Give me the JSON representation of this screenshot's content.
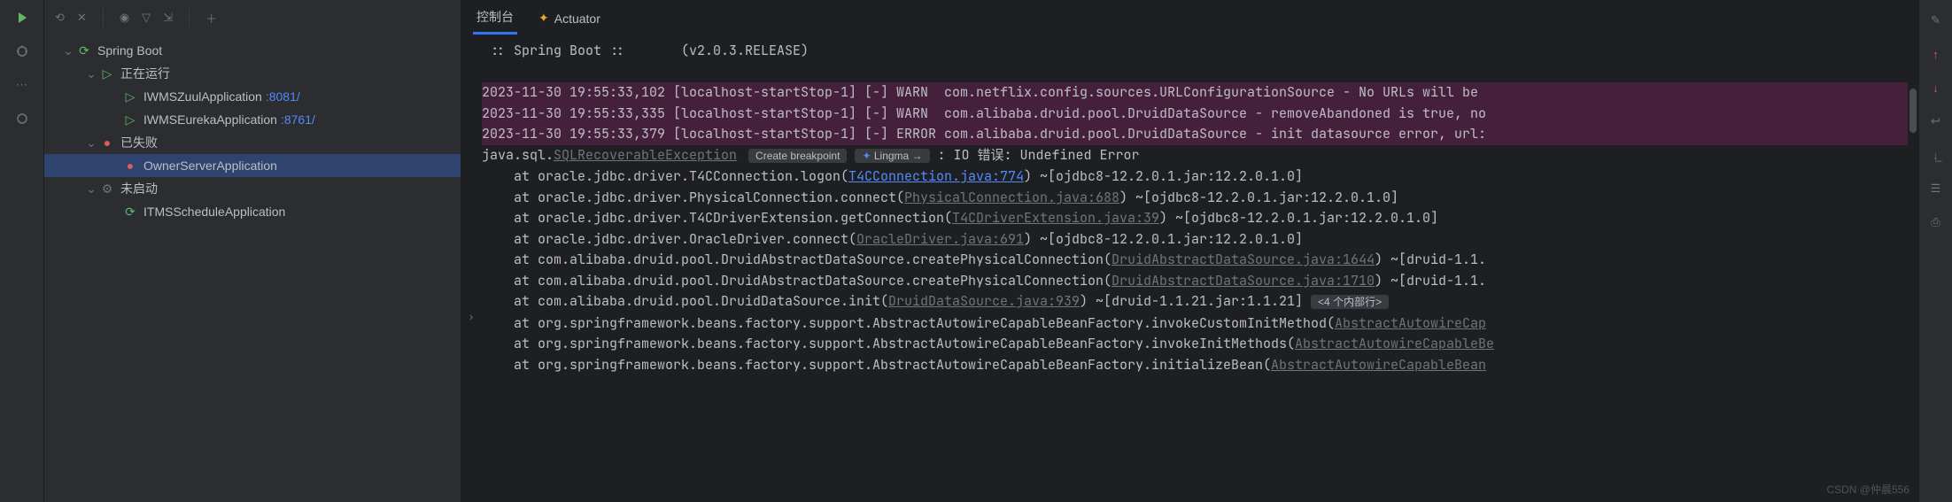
{
  "watermark": "CSDN @仲晨556",
  "tree": {
    "root": "Spring Boot",
    "running": {
      "label": "正在运行",
      "apps": [
        {
          "name": "IWMSZuulApplication",
          "port": ":8081/"
        },
        {
          "name": "IWMSEurekaApplication",
          "port": ":8761/"
        }
      ]
    },
    "failed": {
      "label": "已失败",
      "apps": [
        {
          "name": "OwnerServerApplication"
        }
      ]
    },
    "not_started": {
      "label": "未启动",
      "apps": [
        {
          "name": "ITMSScheduleApplication"
        }
      ]
    }
  },
  "tabs": {
    "console": "控制台",
    "actuator": "Actuator"
  },
  "console": {
    "banner": " :: Spring Boot ::       (v2.0.3.RELEASE)",
    "lines": [
      {
        "type": "warn",
        "ts": "2023-11-30 19:55:33,102",
        "thread": "[localhost-startStop-1]",
        "marker": "[-]",
        "level": "WARN ",
        "logger": "com.netflix.config.sources.URLConfigurationSource",
        "msg": " - No URLs will be "
      },
      {
        "type": "warn",
        "ts": "2023-11-30 19:55:33,335",
        "thread": "[localhost-startStop-1]",
        "marker": "[-]",
        "level": "WARN ",
        "logger": "com.alibaba.druid.pool.DruidDataSource",
        "msg": " - removeAbandoned is true, no"
      },
      {
        "type": "error",
        "ts": "2023-11-30 19:55:33,379",
        "thread": "[localhost-startStop-1]",
        "marker": "[-]",
        "level": "ERROR",
        "logger": "com.alibaba.druid.pool.DruidDataSource",
        "msg": " - init datasource error, url:"
      }
    ],
    "exception": {
      "prefix": "java.sql.",
      "class": "SQLRecoverableException",
      "bp": "Create breakpoint",
      "lingma": "Lingma",
      "suffix": " : IO 错误: Undefined Error"
    },
    "stack": [
      {
        "pre": "at oracle.jdbc.driver.T4CConnection.logon(",
        "link": "T4CConnection.java:774",
        "post": ") ~[ojdbc8-12.2.0.1.jar:12.2.0.1.0]",
        "active": true
      },
      {
        "pre": "at oracle.jdbc.driver.PhysicalConnection.connect(",
        "link": "PhysicalConnection.java:688",
        "post": ") ~[ojdbc8-12.2.0.1.jar:12.2.0.1.0]"
      },
      {
        "pre": "at oracle.jdbc.driver.T4CDriverExtension.getConnection(",
        "link": "T4CDriverExtension.java:39",
        "post": ") ~[ojdbc8-12.2.0.1.jar:12.2.0.1.0]"
      },
      {
        "pre": "at oracle.jdbc.driver.OracleDriver.connect(",
        "link": "OracleDriver.java:691",
        "post": ") ~[ojdbc8-12.2.0.1.jar:12.2.0.1.0]"
      },
      {
        "pre": "at com.alibaba.druid.pool.DruidAbstractDataSource.createPhysicalConnection(",
        "link": "DruidAbstractDataSource.java:1644",
        "post": ") ~[druid-1.1."
      },
      {
        "pre": "at com.alibaba.druid.pool.DruidAbstractDataSource.createPhysicalConnection(",
        "link": "DruidAbstractDataSource.java:1710",
        "post": ") ~[druid-1.1."
      },
      {
        "pre": "at com.alibaba.druid.pool.DruidDataSource.init(",
        "link": "DruidDataSource.java:939",
        "post": ") ~[druid-1.1.21.jar:1.1.21]",
        "more": "<4 个内部行>"
      },
      {
        "pre": "at org.springframework.beans.factory.support.AbstractAutowireCapableBeanFactory.invokeCustomInitMethod(",
        "link": "AbstractAutowireCap",
        "post": ""
      },
      {
        "pre": "at org.springframework.beans.factory.support.AbstractAutowireCapableBeanFactory.invokeInitMethods(",
        "link": "AbstractAutowireCapableBe",
        "post": ""
      },
      {
        "pre": "at org.springframework.beans.factory.support.AbstractAutowireCapableBeanFactory.initializeBean(",
        "link": "AbstractAutowireCapableBean",
        "post": ""
      }
    ]
  }
}
